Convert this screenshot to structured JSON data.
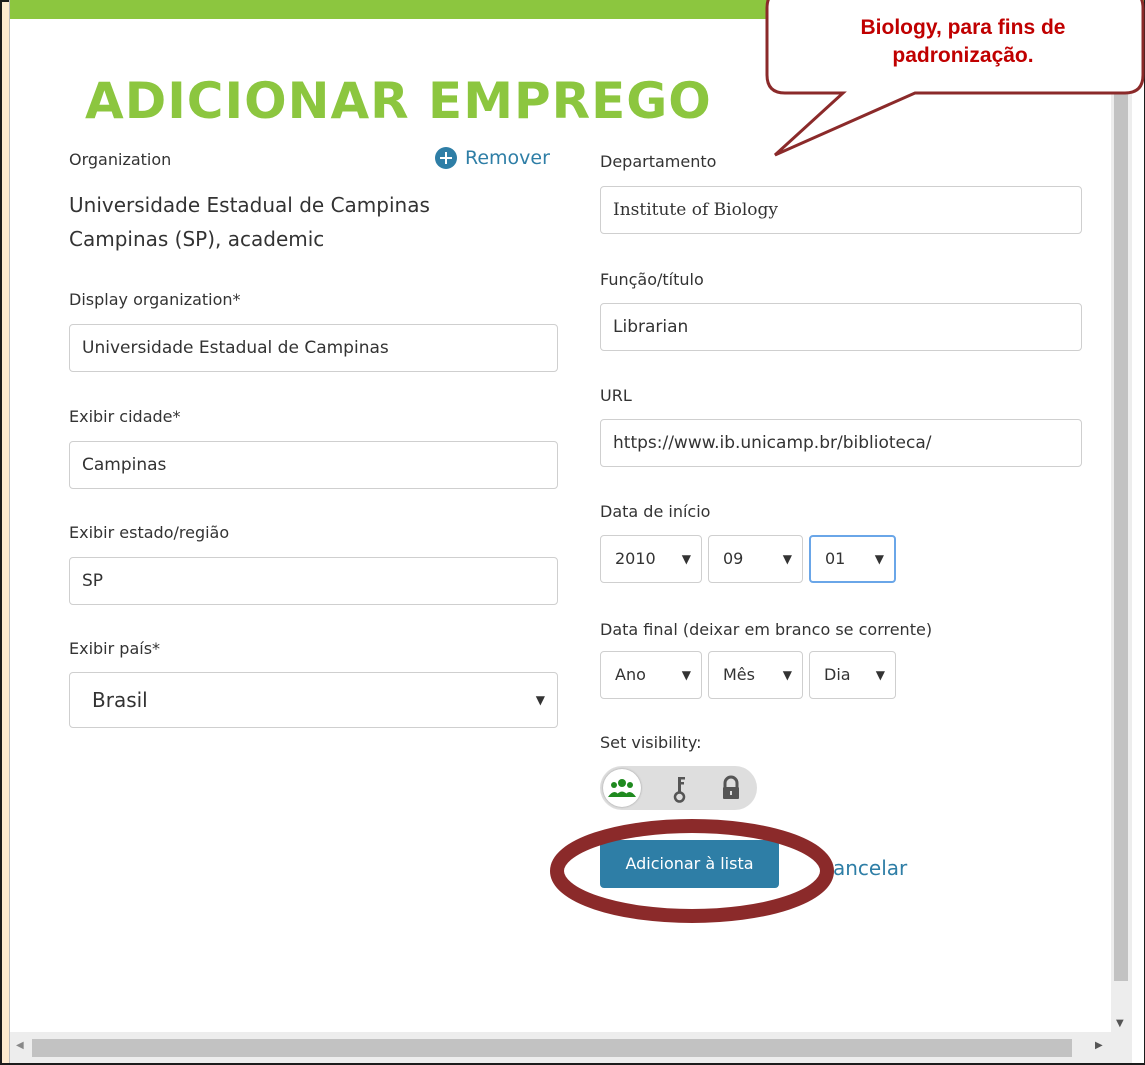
{
  "title": "ADICIONAR EMPREGO",
  "callout": {
    "line1": "Biology, para fins de",
    "line2": "padronização."
  },
  "organization": {
    "label": "Organization",
    "remove_label": "Remover",
    "name": "Universidade Estadual de Campinas",
    "location": "Campinas (SP), academic"
  },
  "display_org": {
    "label": "Display organization*",
    "value": "Universidade Estadual de Campinas"
  },
  "city": {
    "label": "Exibir cidade*",
    "value": "Campinas"
  },
  "state": {
    "label": "Exibir estado/região",
    "value": "SP"
  },
  "country": {
    "label": "Exibir país*",
    "value": "Brasil"
  },
  "department": {
    "label": "Departamento",
    "value": "Institute of Biology"
  },
  "role": {
    "label": "Função/título",
    "value": "Librarian"
  },
  "url": {
    "label": "URL",
    "value": "https://www.ib.unicamp.br/biblioteca/"
  },
  "start_date": {
    "label": "Data de início",
    "year": "2010",
    "month": "09",
    "day": "01"
  },
  "end_date": {
    "label": "Data final (deixar em branco se corrente)",
    "year": "Ano",
    "month": "Mês",
    "day": "Dia"
  },
  "visibility": {
    "label": "Set visibility:",
    "selected": "public"
  },
  "actions": {
    "add_label": "Adicionar à lista",
    "cancel_label": "cancelar"
  },
  "colors": {
    "accent_green": "#8cc63f",
    "button_blue": "#2e7ea6",
    "callout_red": "#c00000",
    "annotation_border": "#8b2a2a"
  },
  "icons": {
    "remove": "plus-circle-icon",
    "public": "people-icon",
    "limited": "key-icon",
    "private": "lock-icon"
  }
}
